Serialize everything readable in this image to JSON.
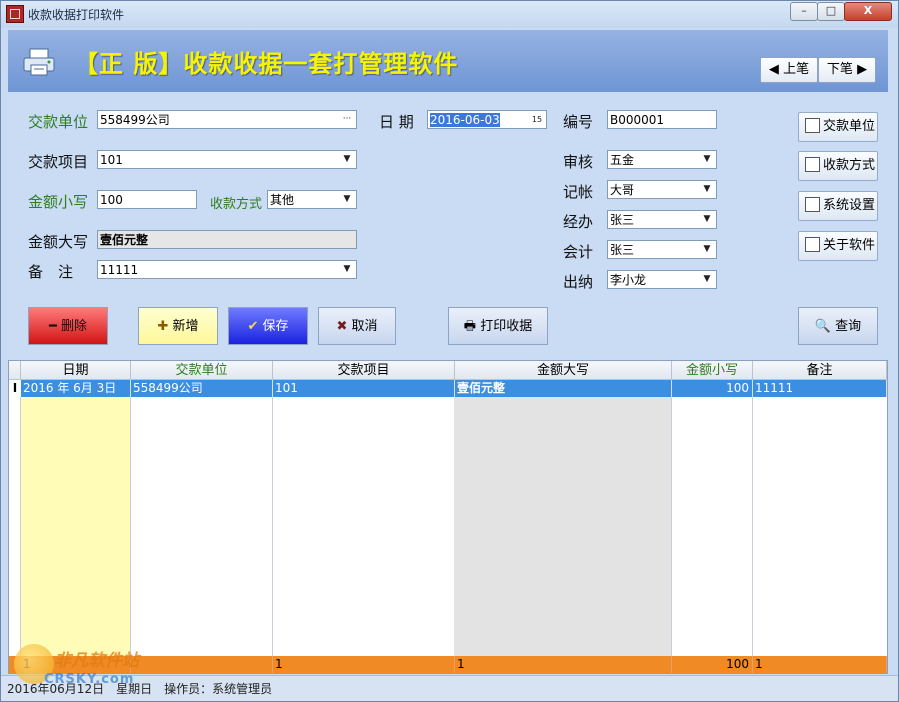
{
  "window": {
    "title": "收款收据打印软件",
    "min": "–",
    "max": "□",
    "close": "X"
  },
  "banner": {
    "title": "【正 版】收款收据一套打管理软件",
    "prev": "上笔",
    "next": "下笔"
  },
  "form": {
    "payer_label": "交款单位",
    "payer_value": "558499公司",
    "item_label": "交款项目",
    "item_value": "101",
    "amount_label": "金额小写",
    "amount_value": "100",
    "method_label": "收款方式",
    "method_value": "其他",
    "amount_cn_label": "金额大写",
    "amount_cn_value": "壹佰元整",
    "remark_label": "备　注",
    "remark_value": "11111",
    "date_label": "日 期",
    "date_value": "2016-06-03",
    "no_label": "编号",
    "no_value": "B000001",
    "auditor_label": "审核",
    "auditor_value": "五金",
    "bookkeeper_label": "记帐",
    "bookkeeper_value": "大哥",
    "handler_label": "经办",
    "handler_value": "张三",
    "accountant_label": "会计",
    "accountant_value": "张三",
    "cashier_label": "出纳",
    "cashier_value": "李小龙"
  },
  "side_buttons": [
    "交款单位",
    "收款方式",
    "系统设置",
    "关于软件"
  ],
  "actions": {
    "delete": "删除",
    "add": "新增",
    "save": "保存",
    "cancel": "取消",
    "print": "打印收据",
    "query": "查询"
  },
  "grid": {
    "columns": [
      "日期",
      "交款单位",
      "交款项目",
      "金额大写",
      "金额小写",
      "备注"
    ],
    "rows": [
      {
        "date": "2016 年 6月 3日",
        "payer": "558499公司",
        "item": "101",
        "amount_cn": "壹佰元整",
        "amount": "100",
        "remark": "11111"
      }
    ],
    "summary": {
      "date": "1",
      "item": "1",
      "amount_cn": "1",
      "amount": "100",
      "remark": "1"
    }
  },
  "status": {
    "text": "2016年06月12日　星期日　操作员：系统管理员"
  },
  "watermark": {
    "brand": "非凡软件站",
    "sub": "CRSKY.com"
  }
}
